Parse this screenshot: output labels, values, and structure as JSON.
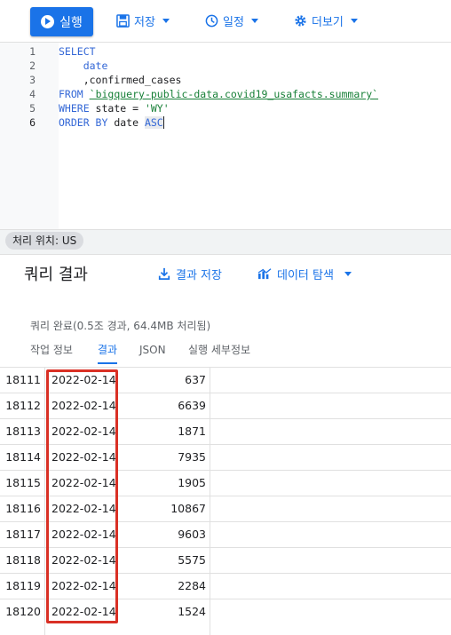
{
  "toolbar": {
    "run_label": "실행",
    "save_label": "저장",
    "schedule_label": "일정",
    "more_label": "더보기"
  },
  "editor": {
    "lines": [
      {
        "num": "1",
        "text": "SELECT"
      },
      {
        "num": "2",
        "text": "    date"
      },
      {
        "num": "3",
        "text": "    ,confirmed_cases"
      },
      {
        "num": "4",
        "kw": "FROM",
        "str": "`bigquery-public-data.covid19_usafacts.summary`"
      },
      {
        "num": "5",
        "kw": "WHERE",
        "rest": " state = ",
        "str": "'WY'"
      },
      {
        "num": "6",
        "kw": "ORDER BY",
        "rest": " date ",
        "kw2": "ASC"
      }
    ]
  },
  "region": {
    "label": "처리 위치: US"
  },
  "results": {
    "title": "쿼리 결과",
    "save_results_label": "결과 저장",
    "explore_label": "데이터 탐색",
    "status": "쿼리 완료(0.5조 경과, 64.4MB 처리됨)",
    "tabs": [
      "작업 정보",
      "결과",
      "JSON",
      "실행 세부정보"
    ],
    "rows": [
      {
        "num": "18111",
        "date": "2022-02-14",
        "value": "637"
      },
      {
        "num": "18112",
        "date": "2022-02-14",
        "value": "6639"
      },
      {
        "num": "18113",
        "date": "2022-02-14",
        "value": "1871"
      },
      {
        "num": "18114",
        "date": "2022-02-14",
        "value": "7935"
      },
      {
        "num": "18115",
        "date": "2022-02-14",
        "value": "1905"
      },
      {
        "num": "18116",
        "date": "2022-02-14",
        "value": "10867"
      },
      {
        "num": "18117",
        "date": "2022-02-14",
        "value": "9603"
      },
      {
        "num": "18118",
        "date": "2022-02-14",
        "value": "5575"
      },
      {
        "num": "18119",
        "date": "2022-02-14",
        "value": "2284"
      },
      {
        "num": "18120",
        "date": "2022-02-14",
        "value": "1524"
      }
    ]
  },
  "colors": {
    "accent": "#1a73e8",
    "highlight": "#d93025"
  }
}
